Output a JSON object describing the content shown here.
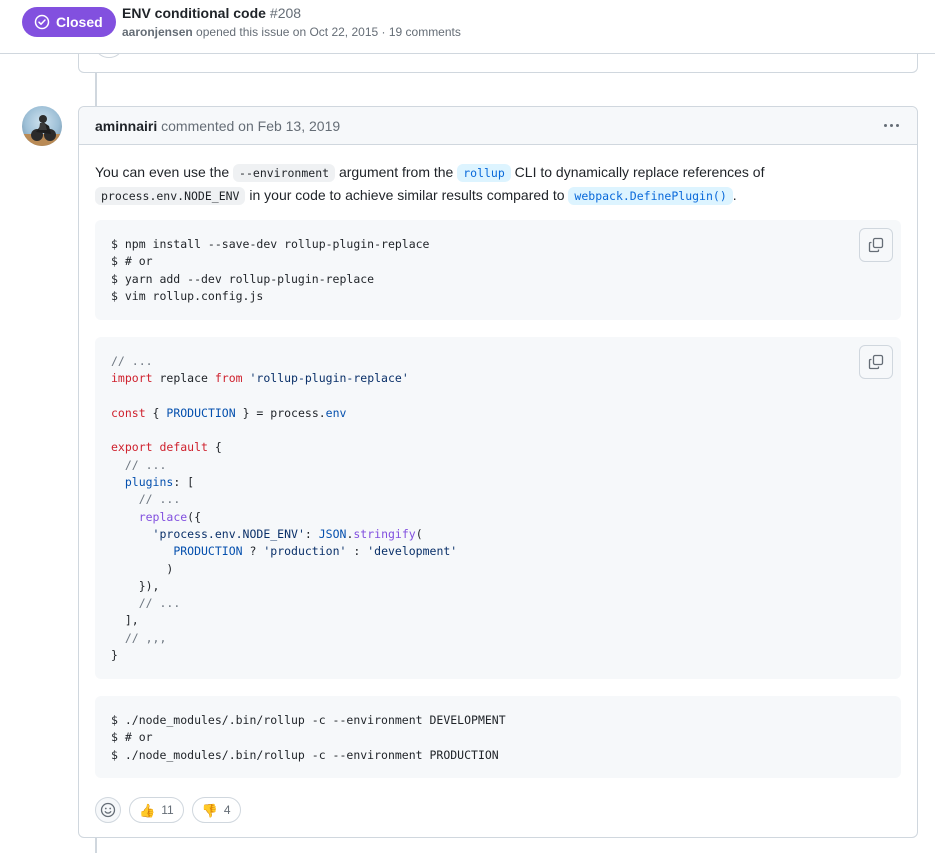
{
  "issue": {
    "state": "Closed",
    "title": "ENV conditional code",
    "number": "#208",
    "author": "aaronjensen",
    "meta_rest": "opened this issue on Oct 22, 2015 · 19 comments"
  },
  "comment": {
    "author": "aminnairi",
    "meta_rest": "commented on Feb 13, 2019",
    "paragraph": {
      "t1": "You can even use the ",
      "c1": "--environment",
      "t2": " argument from the ",
      "c2": "rollup",
      "t3": " CLI to dynamically replace references of",
      "c3": "process.env.NODE_ENV",
      "t4": " in your code to achieve similar results compared to ",
      "c4": "webpack.DefinePlugin()",
      "t5": "."
    },
    "code1": [
      "$ npm install --save-dev rollup-plugin-replace",
      "$ # or",
      "$ yarn add --dev rollup-plugin-replace",
      "$ vim rollup.config.js"
    ],
    "code3": [
      "$ ./node_modules/.bin/rollup -c --environment DEVELOPMENT",
      "$ # or",
      "$ ./node_modules/.bin/rollup -c --environment PRODUCTION"
    ],
    "code2": {
      "l1_comment": "// ...",
      "l2_kw": "import",
      "l2_mid": " replace ",
      "l2_kw2": "from",
      "l2_str": "'rollup-plugin-replace'",
      "l3_kw": "const",
      "l3_open": " { ",
      "l3_const": "PRODUCTION",
      "l3_close": " } = process.",
      "l3_env": "env",
      "l4_kw": "export",
      "l4_kw2": "default",
      "l4_rest": " {",
      "l5_comment": "// ...",
      "l6_key": "plugins",
      "l6_rest": ": [",
      "l7_comment": "// ...",
      "l8_fn": "replace",
      "l8_rest": "({",
      "l9_str": "'process.env.NODE_ENV'",
      "l9_colon": ": ",
      "l9_json": "JSON",
      "l9_dot": ".",
      "l9_fn": "stringify",
      "l9_paren": "(",
      "l10_const": "PRODUCTION",
      "l10_q": " ? ",
      "l10_str1": "'production'",
      "l10_c": " : ",
      "l10_str2": "'development'",
      "l11": ")",
      "l12": "}),",
      "l13_comment": "// ...",
      "l14": "],",
      "l15_comment": "// ,,,",
      "l16": "}"
    },
    "reactions": [
      {
        "emoji": "👍",
        "count": "11"
      },
      {
        "emoji": "👎",
        "count": "4"
      }
    ]
  },
  "colors": {
    "closed_badge": "#8250df",
    "border": "#d0d7de",
    "link": "#0969da"
  },
  "icons": {
    "state": "circle-check-icon",
    "kebab": "kebab-horizontal-icon",
    "copy": "copy-icon",
    "smiley": "smiley-icon"
  }
}
